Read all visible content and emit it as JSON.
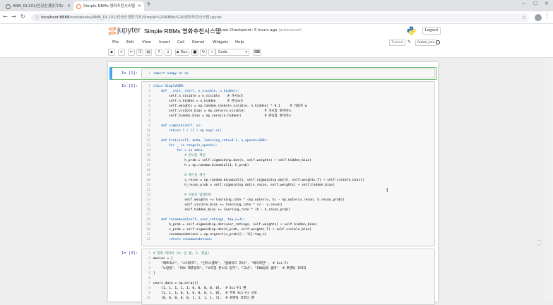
{
  "browser": {
    "tabs": [
      {
        "label": "ANN_DL101/인공신경망기초/"
      },
      {
        "label": "Simple RBMs 영화추천시스템"
      }
    ],
    "url_host": "localhost:8888",
    "url_path": "/notebooks/ANN_DL101/인공신경망기초/Simple%20RBMs%20영화추천시스템.ipynb"
  },
  "jupyter": {
    "logo_text": "jupyter",
    "notebook_title": "Simple RBMs 영화추천시스템",
    "checkpoint": "Last Checkpoint: 5 hours ago",
    "autosave": "(autosaved)",
    "logout_label": "Logout",
    "menu": [
      "File",
      "Edit",
      "View",
      "Insert",
      "Cell",
      "Kernel",
      "Widgets",
      "Help"
    ],
    "trusted_label": "Trusted",
    "kernel_name": "fusion_env",
    "run_label": "Run",
    "cell_type": "Code"
  },
  "cells": [
    {
      "prompt": "In [1]:",
      "lines": [
        {
          "n": "1",
          "code": "import numpy as np"
        }
      ]
    },
    {
      "prompt": "In [2]:",
      "lines": [
        {
          "n": "1",
          "code": "class SimpleRBM:"
        },
        {
          "n": "2",
          "code": "    def __init__(self, n_visible, n_hidden):"
        },
        {
          "n": "3",
          "code": "        self.n_visible = n_visible    # 가시노드"
        },
        {
          "n": "4",
          "code": "        self.n_hidden = n_hidden      # 은닉노드"
        },
        {
          "n": "5",
          "code": "        self.weights = np.random.randn(n_visible, n_hidden) * 0.1     # 가중치 w"
        },
        {
          "n": "6",
          "code": "        self.visible_bias = np.zeros(n_visible)          # 가시층 바이어스"
        },
        {
          "n": "7",
          "code": "        self.hidden_bias = np.zeros(n_hidden)            # 은닉층 바이어스"
        },
        {
          "n": "8",
          "code": ""
        },
        {
          "n": "9",
          "code": "    def sigmoid(self, x):"
        },
        {
          "n": "10",
          "code": "        return 1 / (1 + np.exp(-x))"
        },
        {
          "n": "11",
          "code": ""
        },
        {
          "n": "12",
          "code": "    def train(self, data, learning_rate=0.1, n_epochs=100):"
        },
        {
          "n": "13",
          "code": "        for _ in range(n_epochs):"
        },
        {
          "n": "14",
          "code": "            for v in data:"
        },
        {
          "n": "15",
          "code": "                # 은닉층 계산"
        },
        {
          "n": "16",
          "code": "                h_prob = self.sigmoid(np.dot(v, self.weights) + self.hidden_bias)"
        },
        {
          "n": "17",
          "code": "                h = np.random.binomial(1, h_prob)"
        },
        {
          "n": "18",
          "code": ""
        },
        {
          "n": "19",
          "code": "                # 재구성 계산"
        },
        {
          "n": "20",
          "code": "                v_recon = np.random.binomial(1, self.sigmoid(np.dot(h, self.weights.T) + self.visible_bias))"
        },
        {
          "n": "21",
          "code": "                h_recon_prob = self.sigmoid(np.dot(v_recon, self.weights) + self.hidden_bias)"
        },
        {
          "n": "22",
          "code": ""
        },
        {
          "n": "23",
          "code": "                # 가중치 업데이트"
        },
        {
          "n": "24",
          "code": "                self.weights += learning_rate * (np.outer(v, h) - np.outer(v_recon, h_recon_prob))"
        },
        {
          "n": "25",
          "code": "                self.visible_bias += learning_rate * (v - v_recon)"
        },
        {
          "n": "26",
          "code": "                self.hidden_bias += learning_rate * (h - h_recon_prob)"
        },
        {
          "n": "27",
          "code": ""
        },
        {
          "n": "28",
          "code": "    def recommend(self, user_ratings, top_n=3):"
        },
        {
          "n": "29",
          "code": "        h_prob = self.sigmoid(np.dot(user_ratings, self.weights) + self.hidden_bias)"
        },
        {
          "n": "30",
          "code": "        v_prob = self.sigmoid(np.dot(h_prob, self.weights.T) + self.visible_bias)"
        },
        {
          "n": "31",
          "code": "        recommendations = np.argsort(v_prob)[::-1][:top_n]"
        },
        {
          "n": "32",
          "code": "        return recommendations"
        }
      ]
    },
    {
      "prompt": "In [3]:",
      "lines": [
        {
          "n": "1",
          "code": "# 영화 데이터 (0: 안 봄, 1: 봤음)"
        },
        {
          "n": "2",
          "code": "movies = ["
        },
        {
          "n": "3",
          "code": "    \"매트릭스\", \"스타워즈\", \"인터스텔라\", \"블레이드 러너\", \"에이리언\",  # Sci-Fi"
        },
        {
          "n": "4",
          "code": "    \"노팅힐\", \"러브 액츄얼리\", \"브리짓 존스의 일기\", \"그녀\", \"500일의 썸머\"  # 로맨틱 코미디"
        },
        {
          "n": "5",
          "code": "]"
        },
        {
          "n": "6",
          "code": ""
        },
        {
          "n": "7",
          "code": "users_data = np.array(["
        },
        {
          "n": "8",
          "code": "    [1, 1, 1, 1, 1, 0, 0, 0, 0, 0],  # Sci-Fi 팬"
        },
        {
          "n": "9",
          "code": "    [1, 1, 1, 0, 1, 0, 0, 0, 1, 0],  # 주로 Sci-Fi 선호"
        },
        {
          "n": "10",
          "code": "    [0, 0, 0, 0, 0, 1, 1, 1, 1, 1],  # 로맨틱 코미디 팬"
        }
      ]
    }
  ]
}
